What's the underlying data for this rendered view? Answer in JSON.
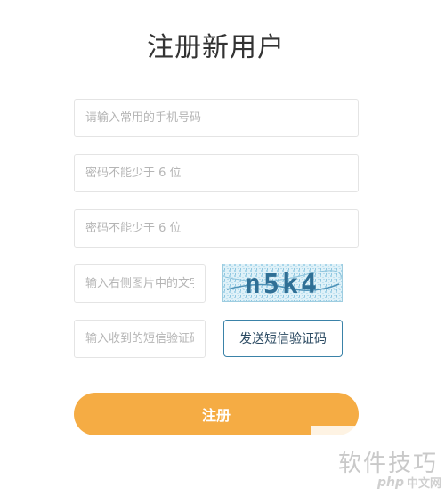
{
  "page": {
    "title": "注册新用户"
  },
  "form": {
    "phone_placeholder": "请输入常用的手机号码",
    "password_placeholder": "密码不能少于 6 位",
    "password_confirm_placeholder": "密码不能少于 6 位",
    "image_code_placeholder": "输入右侧图片中的文字",
    "sms_code_placeholder": "输入收到的短信验证码",
    "captcha_text": "n5k4",
    "sms_button_label": "发送短信验证码",
    "register_button_label": "注册"
  },
  "watermark": {
    "text": "软件技巧",
    "logo_php": "php",
    "logo_site": "中文网"
  },
  "colors": {
    "register_button": "#f5ac44",
    "sms_button_border": "#3a82a8",
    "captcha_text": "#2f6f95",
    "field_border": "#e4e4e4"
  }
}
